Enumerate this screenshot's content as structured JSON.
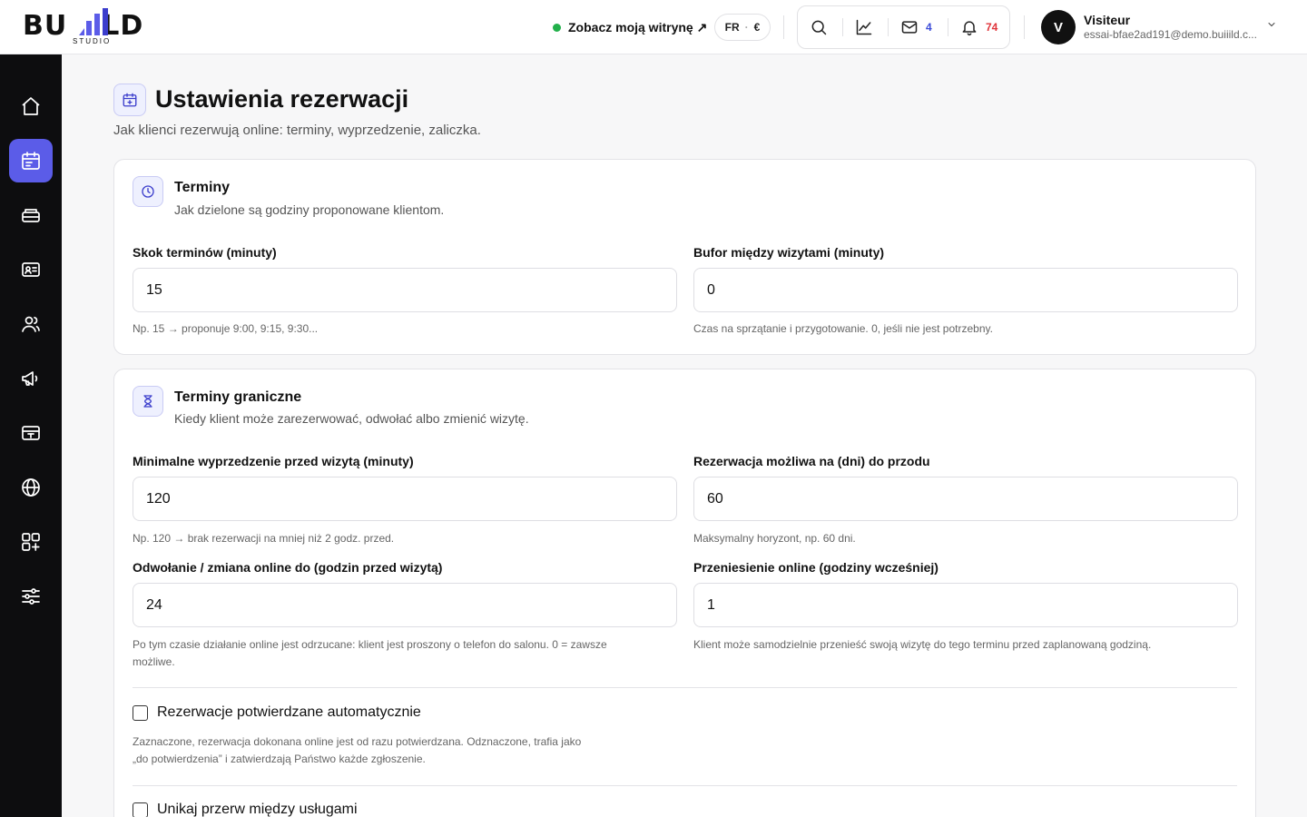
{
  "app": {
    "logo_text_left": "BU",
    "logo_text_right": "LD",
    "logo_sub": "STUDIO"
  },
  "topbar": {
    "site_link": "Zobacz moją witrynę ↗",
    "lang": "FR",
    "currency": "€",
    "messages_count": "4",
    "notifications_count": "74",
    "user_initial": "V",
    "user_name": "Visiteur",
    "user_email": "essai-bfae2ad191@demo.buiiild.c..."
  },
  "sidebar": {
    "items": [
      {
        "icon": "home-icon"
      },
      {
        "icon": "calendar-icon",
        "active": true
      },
      {
        "icon": "services-icon"
      },
      {
        "icon": "contact-card-icon"
      },
      {
        "icon": "users-icon"
      },
      {
        "icon": "megaphone-icon"
      },
      {
        "icon": "payment-icon"
      },
      {
        "icon": "globe-icon"
      },
      {
        "icon": "apps-icon"
      },
      {
        "icon": "sliders-icon"
      }
    ]
  },
  "page": {
    "title": "Ustawienia rezerwacji",
    "subtitle": "Jak klienci rezerwują online: terminy, wyprzedzenie, zaliczka."
  },
  "terminy": {
    "title": "Terminy",
    "subtitle": "Jak dzielone są godziny proponowane klientom.",
    "step_label": "Skok terminów (minuty)",
    "step_value": "15",
    "step_hint": "Np. 15 → proponuje 9:00, 9:15, 9:30...",
    "buffer_label": "Bufor między wizytami (minuty)",
    "buffer_value": "0",
    "buffer_hint": "Czas na sprzątanie i przygotowanie. 0, jeśli nie jest potrzebny."
  },
  "graniczne": {
    "title": "Terminy graniczne",
    "subtitle": "Kiedy klient może zarezerwować, odwołać albo zmienić wizytę.",
    "min_label": "Minimalne wyprzedzenie przed wizytą (minuty)",
    "min_value": "120",
    "min_hint": "Np. 120 → brak rezerwacji na mniej niż 2 godz. przed.",
    "days_label": "Rezerwacja możliwa na (dni) do przodu",
    "days_value": "60",
    "days_hint": "Maksymalny horyzont, np. 60 dni.",
    "cancel_label": "Odwołanie / zmiana online do (godzin przed wizytą)",
    "cancel_value": "24",
    "cancel_hint_1": "Po tym czasie działanie online jest odrzucane: klient jest proszony o telefon do salonu. 0 = zawsze",
    "cancel_hint_2": "możliwe.",
    "move_label": "Przeniesienie online (godziny wcześniej)",
    "move_value": "1",
    "move_hint": "Klient może samodzielnie przenieść swoją wizytę do tego terminu przed zaplanowaną godziną.",
    "auto_label": "Rezerwacje potwierdzane automatycznie",
    "auto_checked": false,
    "auto_hint_1": "Zaznaczone, rezerwacja dokonana online jest od razu potwierdzana. Odznaczone, trafia jako",
    "auto_hint_2": "„do potwierdzenia” i zatwierdzają Państwo każde zgłoszenie.",
    "gaps_label": "Unikaj przerw między usługami",
    "gaps_checked": false
  },
  "colors": {
    "accent": "#5b5ce8",
    "sidebar_bg": "#0d0d0f",
    "status_online": "#22b04b",
    "messages_badge": "#3b4bd8",
    "notifications_badge": "#e0343a"
  }
}
